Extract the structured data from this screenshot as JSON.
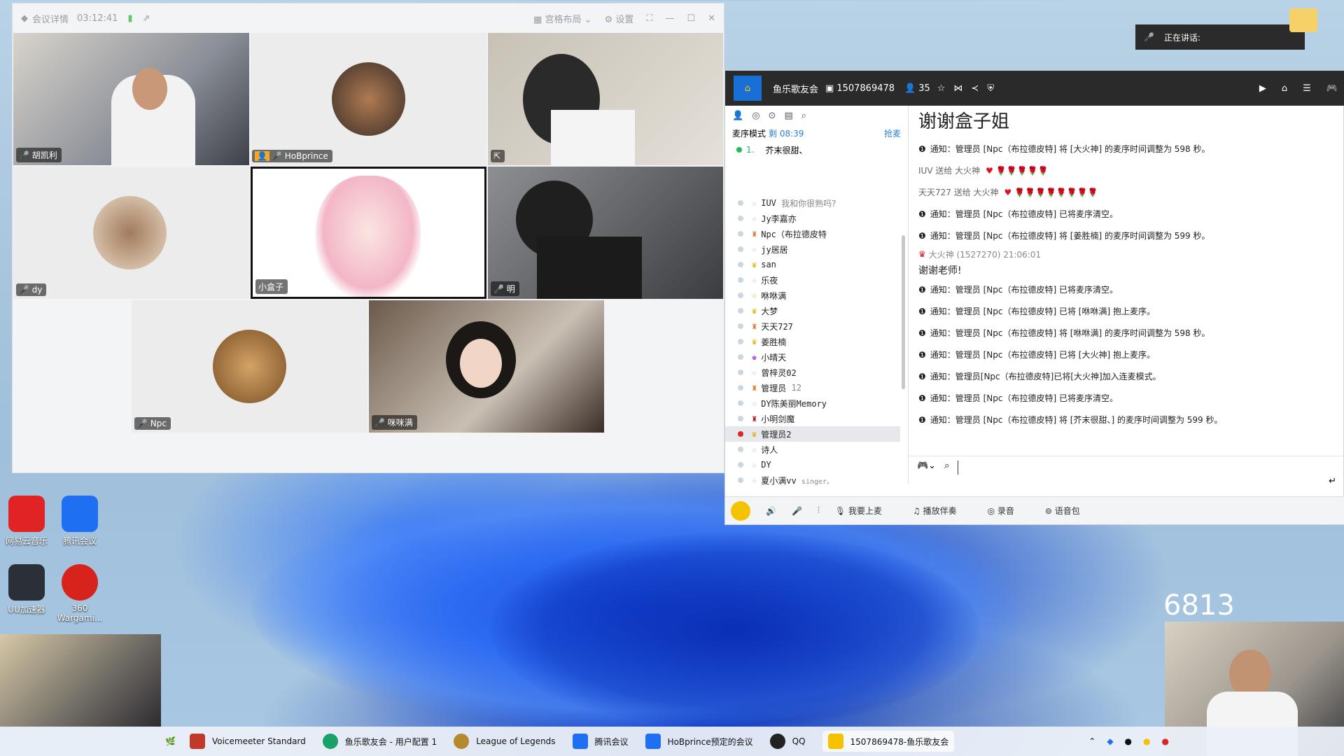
{
  "meeting": {
    "title": "会议详情",
    "timer": "03:12:41",
    "layout_label": "宫格布局",
    "settings_label": "设置",
    "tiles": [
      "胡凯利",
      "HoBprince",
      "",
      "dy",
      "小盒子",
      "明",
      "Npc",
      "咪咪满"
    ]
  },
  "speaking": {
    "label": "正在讲话:"
  },
  "chat": {
    "room_name": "鱼乐歌友会",
    "room_id": "1507869478",
    "member_count": "35",
    "mode_label": "麦序模式",
    "mode_timer": "剩 08:39",
    "grab_label": "抢麦",
    "queue_first": "1.",
    "queue_name": "芥末很甜、",
    "headline": "谢谢盒子姐",
    "users": [
      {
        "name": "IUV",
        "extra": "我和你很熟吗?"
      },
      {
        "name": "Jy李嘉亦",
        "extra": ""
      },
      {
        "name": "Npc（布拉德皮特",
        "extra": ""
      },
      {
        "name": "jy居居",
        "extra": ""
      },
      {
        "name": "san",
        "extra": ""
      },
      {
        "name": "乐夜",
        "extra": ""
      },
      {
        "name": "咻咻满",
        "extra": ""
      },
      {
        "name": "大梦",
        "extra": ""
      },
      {
        "name": "天天727",
        "extra": ""
      },
      {
        "name": "姜胜楠",
        "extra": ""
      },
      {
        "name": "小晴天",
        "extra": ""
      },
      {
        "name": "曾梓灵02",
        "extra": ""
      },
      {
        "name": "管理员",
        "extra": "12"
      },
      {
        "name": "DY陈美丽Memory",
        "extra": ""
      },
      {
        "name": "小明剑魔",
        "extra": ""
      },
      {
        "name": "管理员2",
        "extra": ""
      },
      {
        "name": "诗人",
        "extra": ""
      },
      {
        "name": "DY",
        "extra": ""
      },
      {
        "name": "夏小满vv",
        "extra": "singer。"
      }
    ],
    "messages": [
      {
        "kind": "notice",
        "text": "通知：管理员 [Npc（布拉德皮特] 将 [大火神] 的麦序时间调整为 598 秒。"
      },
      {
        "kind": "gift",
        "text": "IUV 送给 大火神"
      },
      {
        "kind": "gift",
        "text": "天天727 送给 大火神"
      },
      {
        "kind": "notice",
        "text": "通知：管理员 [Npc（布拉德皮特] 已将麦序清空。"
      },
      {
        "kind": "notice",
        "text": "通知：管理员 [Npc（布拉德皮特] 将 [姜胜楠] 的麦序时间调整为 599 秒。"
      },
      {
        "kind": "chat",
        "text": "大火神 (1527270)  21:06:01"
      },
      {
        "kind": "big",
        "text": "谢谢老师!"
      },
      {
        "kind": "notice",
        "text": "通知：管理员 [Npc（布拉德皮特] 已将麦序清空。"
      },
      {
        "kind": "notice",
        "text": "通知：管理员 [Npc（布拉德皮特] 已将 [咻咻满] 抱上麦序。"
      },
      {
        "kind": "notice",
        "text": "通知：管理员 [Npc（布拉德皮特] 将 [咻咻满] 的麦序时间调整为 598 秒。"
      },
      {
        "kind": "notice",
        "text": "通知：管理员 [Npc（布拉德皮特] 已将 [大火神] 抱上麦序。"
      },
      {
        "kind": "notice",
        "text": "通知：管理员[Npc（布拉德皮特]已将[大火神]加入连麦模式。"
      },
      {
        "kind": "notice",
        "text": "通知：管理员 [Npc（布拉德皮特] 已将麦序清空。"
      },
      {
        "kind": "notice",
        "text": "通知：管理员 [Npc（布拉德皮特] 将 [芥末很甜、] 的麦序时间调整为 599 秒。"
      }
    ],
    "bottom": {
      "mic_up": "我要上麦",
      "play": "播放伴奏",
      "record": "录音",
      "voice_pack": "语音包"
    }
  },
  "desktop": {
    "icons": [
      "网易云音乐",
      "腾讯会议",
      "UU加速器",
      "360 Wargami..."
    ],
    "counter": "6813"
  },
  "taskbar": {
    "apps": [
      "Voicemeeter Standard",
      "鱼乐歌友会 - 用户配置 1",
      "League of Legends",
      "腾讯会议",
      "HoBprince预定的会议",
      "QQ",
      "1507869478-鱼乐歌友会"
    ]
  }
}
